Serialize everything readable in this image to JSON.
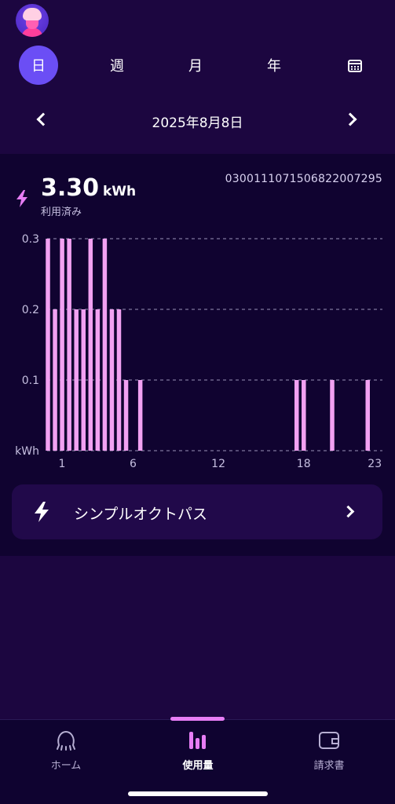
{
  "period_tabs": [
    {
      "label": "日",
      "active": true
    },
    {
      "label": "週",
      "active": false
    },
    {
      "label": "月",
      "active": false
    },
    {
      "label": "年",
      "active": false
    }
  ],
  "icons": {
    "calendar": "calendar-icon",
    "prev": "chevron-left-icon",
    "next": "chevron-right-icon",
    "bolt": "lightning-bolt-icon"
  },
  "date_nav": {
    "date": "2025年8月8日"
  },
  "usage": {
    "total_value": "3.30",
    "unit": "kWh",
    "used_label": "利用済み",
    "meter_id": "0300111071506822007295"
  },
  "chart_data": {
    "type": "bar",
    "x": [
      1,
      1.5,
      2,
      2.5,
      3,
      3.5,
      4,
      4.5,
      5,
      5.5,
      6,
      6.5,
      7,
      7.5,
      8,
      8.5,
      9,
      9.5,
      10,
      10.5,
      11,
      11.5,
      12,
      12.5,
      13,
      13.5,
      14,
      14.5,
      15,
      15.5,
      16,
      16.5,
      17,
      17.5,
      18,
      18.5,
      19,
      19.5,
      20,
      20.5,
      21,
      21.5,
      22,
      22.5,
      23,
      23.5
    ],
    "values": [
      0.3,
      0.2,
      0.3,
      0.3,
      0.2,
      0.2,
      0.3,
      0.2,
      0.3,
      0.2,
      0.2,
      0.1,
      0,
      0.1,
      0,
      0,
      0,
      0,
      0,
      0,
      0,
      0,
      0,
      0,
      0,
      0,
      0,
      0,
      0,
      0,
      0,
      0,
      0,
      0,
      0,
      0.1,
      0.1,
      0,
      0,
      0,
      0.1,
      0,
      0,
      0,
      0,
      0.1
    ],
    "y_ticks": [
      "0.3",
      "0.2",
      "0.1",
      "kWh"
    ],
    "x_ticks": [
      "1",
      "6",
      "12",
      "18",
      "23"
    ],
    "ylim": [
      0,
      0.3
    ],
    "bar_color": "#f2a1f2",
    "grid": "dashed"
  },
  "tariff": {
    "name": "シンプルオクトパス"
  },
  "bottom_nav": [
    {
      "label": "ホーム",
      "icon": "octopus-icon",
      "active": false
    },
    {
      "label": "使用量",
      "icon": "bar-chart-icon",
      "active": true
    },
    {
      "label": "請求書",
      "icon": "wallet-icon",
      "active": false
    }
  ],
  "colors": {
    "background": "#1c0640",
    "card": "#100330",
    "accent": "#6b4ef5",
    "pink": "#e77df5"
  }
}
